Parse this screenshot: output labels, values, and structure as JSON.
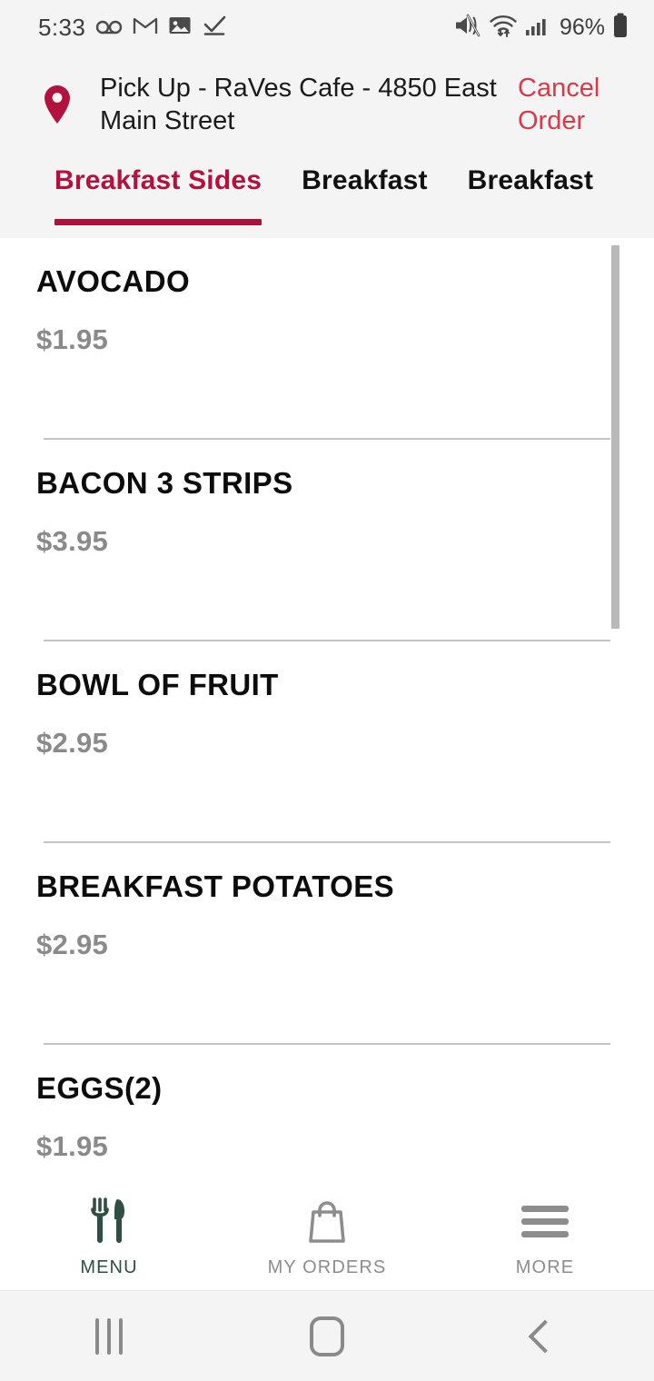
{
  "status_bar": {
    "time": "5:33",
    "battery_percent": "96%",
    "left_icons": [
      "voicemail-icon",
      "gmail-icon",
      "photo-icon",
      "checkmark-icon"
    ],
    "right_icons": [
      "mute-icon",
      "wifi-icon",
      "cellular-signal-icon",
      "battery-icon"
    ]
  },
  "order_header": {
    "location_icon": "location-pin-icon",
    "title": "Pick Up - RaVes Cafe - 4850 East Main Street",
    "cancel_label": "Cancel Order"
  },
  "tabs": {
    "items": [
      {
        "label": "Breakfast  Sides",
        "active": true
      },
      {
        "label": "Breakfast",
        "active": false
      },
      {
        "label": "Breakfast",
        "active": false
      }
    ]
  },
  "menu": {
    "items": [
      {
        "name": "AVOCADO",
        "price": "$1.95"
      },
      {
        "name": "BACON 3 STRIPS",
        "price": "$3.95"
      },
      {
        "name": "BOWL OF FRUIT",
        "price": "$2.95"
      },
      {
        "name": "BREAKFAST POTATOES",
        "price": "$2.95"
      },
      {
        "name": "EGGS(2)",
        "price": "$1.95"
      }
    ]
  },
  "bottom_nav": {
    "items": [
      {
        "label": "MENU",
        "icon": "fork-knife-icon",
        "active": true
      },
      {
        "label": "MY ORDERS",
        "icon": "shopping-bag-icon",
        "active": false
      },
      {
        "label": "MORE",
        "icon": "hamburger-menu-icon",
        "active": false
      }
    ]
  },
  "android_nav": {
    "recents": "recents-icon",
    "home": "home-icon",
    "back": "back-icon"
  },
  "colors": {
    "brand": "#b3123f",
    "accent_underline": "#a8123c",
    "cancel_red": "#d83a4a",
    "menu_active_green": "#2e4f42",
    "price_gray": "#8a8a8a",
    "header_bg": "#f4f4f4"
  }
}
